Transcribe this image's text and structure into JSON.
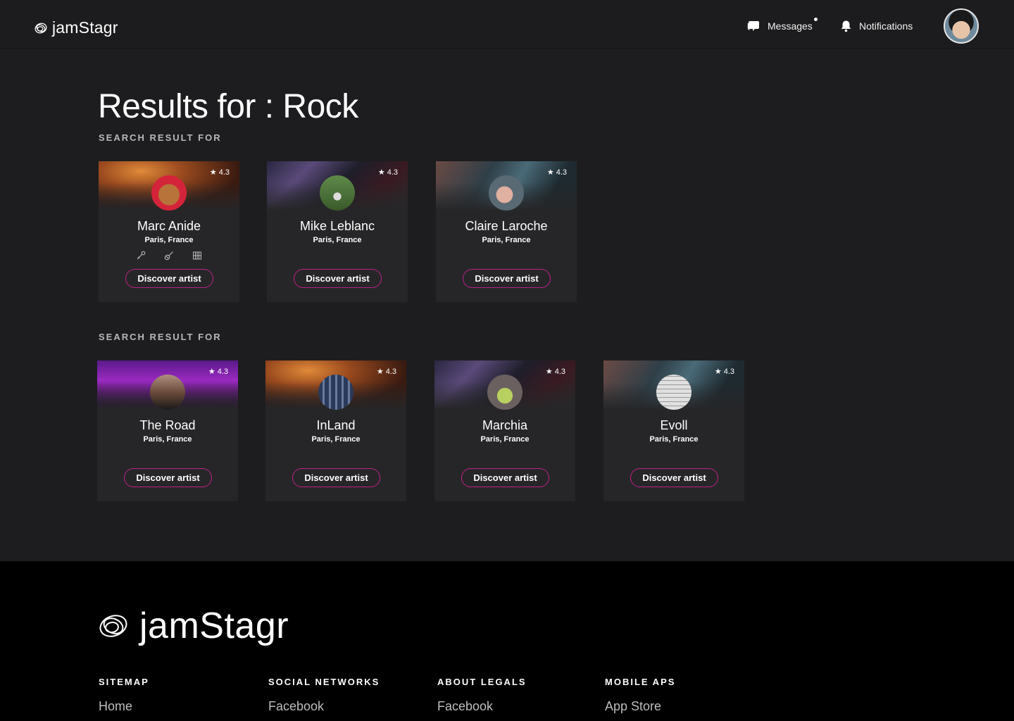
{
  "header": {
    "brand": "jamStagr",
    "messages_label": "Messages",
    "notifications_label": "Notifications"
  },
  "page": {
    "title": "Results for : Rock",
    "section1_label": "SEARCH RESULT FOR",
    "section2_label": "SEARCH RESULT FOR"
  },
  "cards": [
    {
      "name": "Marc Anide",
      "location": "Paris, France",
      "rating": "4.3",
      "button": "Discover artist"
    },
    {
      "name": "Mike Leblanc",
      "location": "Paris, France",
      "rating": "4.3",
      "button": "Discover artist"
    },
    {
      "name": "Claire Laroche",
      "location": "Paris, France",
      "rating": "4.3",
      "button": "Discover artist"
    },
    {
      "name": "The Road",
      "location": "Paris, France",
      "rating": "4.3",
      "button": "Discover artist"
    },
    {
      "name": "InLand",
      "location": "Paris, France",
      "rating": "4.3",
      "button": "Discover artist"
    },
    {
      "name": "Marchia",
      "location": "Paris, France",
      "rating": "4.3",
      "button": "Discover artist"
    },
    {
      "name": "Evoll",
      "location": "Paris, France",
      "rating": "4.3",
      "button": "Discover artist"
    }
  ],
  "instrument_icons": [
    "microphone-icon",
    "guitar-icon",
    "keyboard-icon"
  ],
  "footer": {
    "brand": "jamStagr",
    "columns": [
      {
        "heading": "SITEMAP",
        "link": "Home"
      },
      {
        "heading": "SOCIAL NETWORKS",
        "link": "Facebook"
      },
      {
        "heading": "ABOUT LEGALS",
        "link": "Facebook"
      },
      {
        "heading": "MOBILE APS",
        "link": "App Store"
      }
    ]
  },
  "colors": {
    "accent": "#c0208a",
    "background": "#1d1d1f",
    "card": "#262628",
    "footer": "#000000"
  }
}
